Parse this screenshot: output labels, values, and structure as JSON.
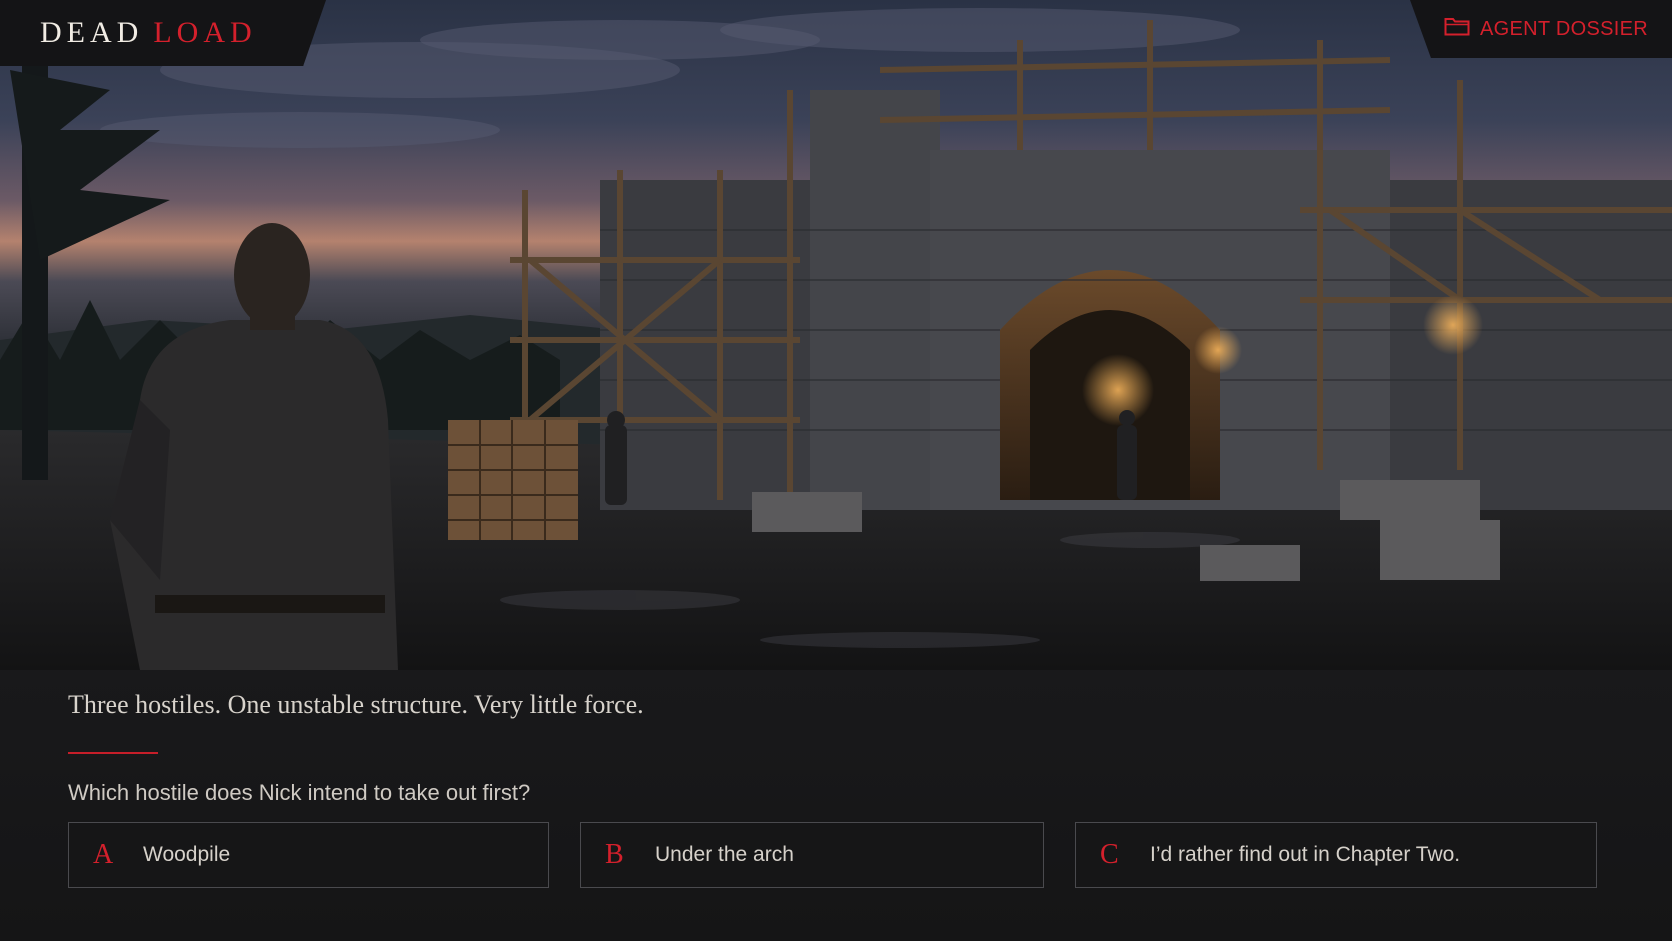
{
  "header": {
    "logo_word1": "DEAD",
    "logo_word2": "LOAD",
    "dossier_label": "AGENT DOSSIER",
    "dossier_icon": "folder-icon"
  },
  "dialogue": {
    "narration": "Three hostiles. One unstable structure. Very little force.",
    "question": "Which hostile does Nick intend to take out first?",
    "choices": [
      {
        "letter": "A",
        "text": "Woodpile"
      },
      {
        "letter": "B",
        "text": "Under the arch"
      },
      {
        "letter": "C",
        "text": "I’d rather find out in Chapter Two."
      }
    ]
  },
  "colors": {
    "accent": "#d4202c",
    "panel": "#151517",
    "text": "#d8d3cc"
  }
}
